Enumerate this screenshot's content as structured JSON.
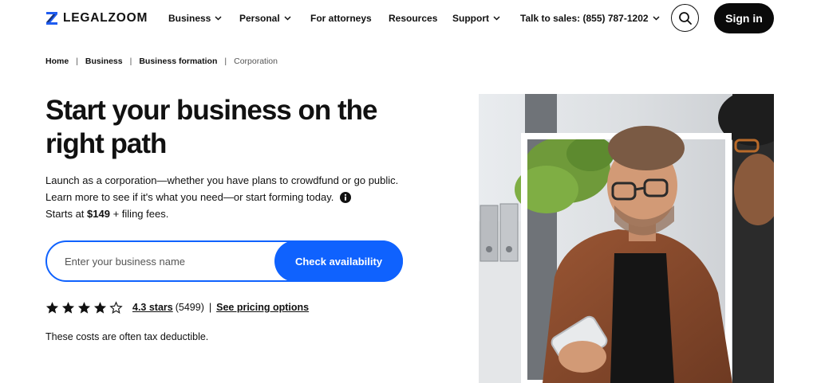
{
  "brand": {
    "name": "LEGALZOOM",
    "logo_icon": "legalzoom-z-logo"
  },
  "nav": {
    "items": [
      {
        "label": "Business",
        "has_dropdown": true
      },
      {
        "label": "Personal",
        "has_dropdown": true
      },
      {
        "label": "For attorneys",
        "has_dropdown": false
      },
      {
        "label": "Resources",
        "has_dropdown": false
      },
      {
        "label": "Support",
        "has_dropdown": true
      },
      {
        "label": "Talk to sales: (855) 787-1202",
        "has_dropdown": true
      }
    ],
    "search_icon": "search-icon",
    "signin_label": "Sign in"
  },
  "breadcrumb": [
    "Home",
    "Business",
    "Business formation",
    "Corporation"
  ],
  "hero": {
    "title": "Start your business on the right path",
    "description": "Launch as a corporation—whether you have plans to crowdfund or go public. Learn more to see if it's what you need—or start forming today.",
    "starts_at_label": "Starts at",
    "price": "$149",
    "price_suffix": "+ filing fees.",
    "info_icon": "info-icon"
  },
  "search": {
    "placeholder": "Enter your business name",
    "value": "",
    "button_label": "Check availability"
  },
  "rating": {
    "stars": 4.3,
    "max_stars": 5,
    "label": "4.3 stars",
    "count": "(5499)",
    "separator": "|",
    "pricing_link": "See pricing options"
  },
  "tax_note": "These costs are often tax deductible.",
  "colors": {
    "accent": "#0f62fe",
    "text": "#111111",
    "signin_bg": "#0a0a0a"
  }
}
